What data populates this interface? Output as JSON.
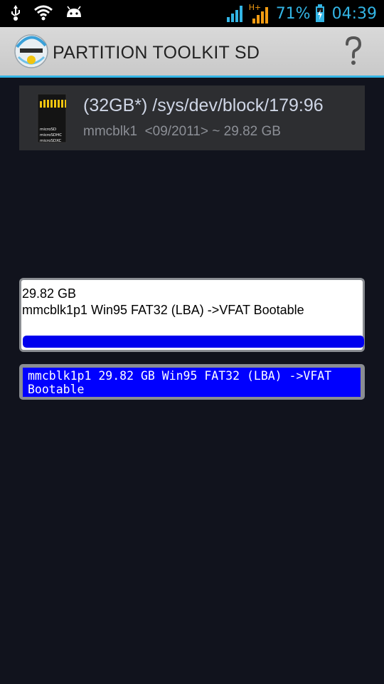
{
  "status_bar": {
    "icons": [
      "usb-icon",
      "wifi-icon",
      "android-icon",
      "signal-icon",
      "hplus-icon",
      "signal-icon-2",
      "battery-charging-icon"
    ],
    "network_type": "H+",
    "battery": "71%",
    "time": "04:39"
  },
  "app_bar": {
    "logo_icon": "partition-toolkit-logo",
    "title": "PARTITION TOOLKIT SD",
    "help_icon": "question-icon"
  },
  "device": {
    "icon": "microsd-card-icon",
    "icon_labels": [
      "microSD",
      "microSDHC",
      "microSDXC"
    ],
    "title": "(32GB*) /sys/dev/block/179:96",
    "subtitle": "mmcblk1  <09/2011> ~ 29.82 GB"
  },
  "partition_card": {
    "size": "29.82 GB",
    "description": "mmcblk1p1 Win95 FAT32 (LBA) ->VFAT Bootable",
    "usage_fraction": 1.0
  },
  "selected_partition": {
    "text": "mmcblk1p1 29.82 GB Win95 FAT32 (LBA) ->VFAT Bootable"
  },
  "colors": {
    "accent": "#33b5e5",
    "background": "#11131d",
    "selection_blue": "#0000ff",
    "bar_blue": "#0000ee"
  }
}
